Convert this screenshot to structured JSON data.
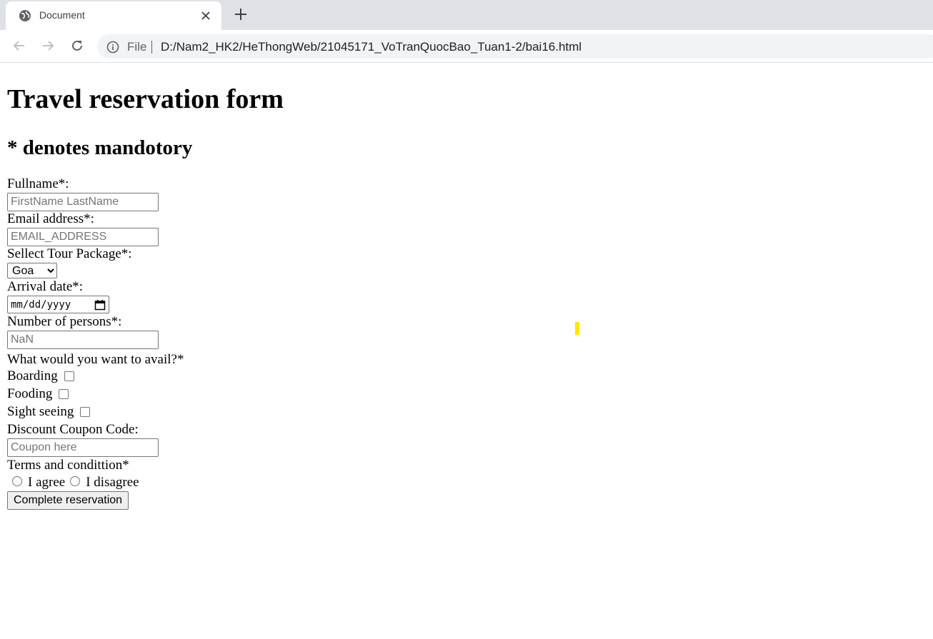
{
  "browser": {
    "tab_title": "Document",
    "url_scheme": "File",
    "url": "D:/Nam2_HK2/HeThongWeb/21045171_VoTranQuocBao_Tuan1-2/bai16.html"
  },
  "page": {
    "title": "Travel reservation form",
    "subtitle": "* denotes mandotory",
    "fullname": {
      "label": "Fullname*:",
      "placeholder": "FirstName LastName"
    },
    "email": {
      "label": "Email address*:",
      "placeholder": "EMAIL_ADDRESS"
    },
    "tour": {
      "label": "Sellect Tour Package*:",
      "selected": "Goa"
    },
    "arrival": {
      "label": "Arrival date*:",
      "value": "mm/dd/yyyy"
    },
    "persons": {
      "label": "Number of persons*:",
      "placeholder": "NaN"
    },
    "avail": {
      "label": "What would you want to avail?*",
      "options": [
        "Boarding",
        "Fooding",
        "Sight seeing"
      ]
    },
    "coupon": {
      "label": "Discount Coupon Code:",
      "placeholder": "Coupon here"
    },
    "terms": {
      "label": "Terms and condittion*",
      "agree": "I agree",
      "disagree": "I disagree"
    },
    "submit_label": "Complete reservation"
  },
  "colors": {
    "tabstrip": "#dee1e6",
    "omnibox": "#f1f3f4",
    "marker": "#ffe600"
  },
  "icons": [
    "globe-icon",
    "close-icon",
    "plus-icon",
    "back-arrow-icon",
    "forward-arrow-icon",
    "reload-icon",
    "info-icon",
    "calendar-icon"
  ]
}
